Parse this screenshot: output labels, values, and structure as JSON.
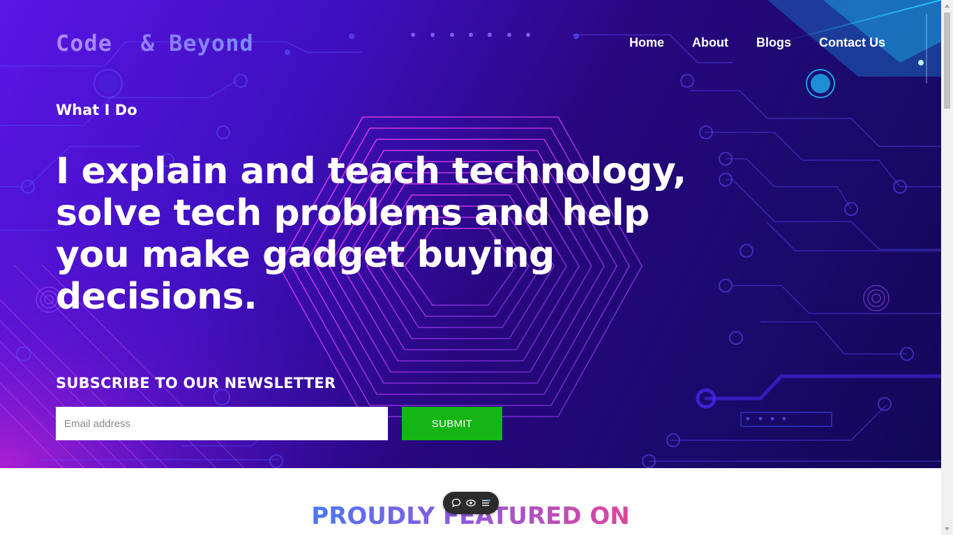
{
  "brand": {
    "name": "Code  & Beyond"
  },
  "nav": {
    "items": [
      "Home",
      "About",
      "Blogs",
      "Contact Us"
    ]
  },
  "hero": {
    "eyebrow": "What I Do",
    "headline": "I explain and teach technology, solve tech problems and help you make gadget buying decisions."
  },
  "newsletter": {
    "title": "SUBSCRIBE TO OUR NEWSLETTER",
    "email_placeholder": "Email address",
    "submit_label": "SUBMIT"
  },
  "featured": {
    "title": "PROUDLY FEATURED ON"
  },
  "floating_toolbar": {
    "icons": [
      "chat-icon",
      "eye-icon",
      "menu-icon"
    ]
  },
  "colors": {
    "accent_green": "#14b514",
    "hero_dark": "#1b0a6e",
    "hero_violet": "#5a16e6"
  }
}
